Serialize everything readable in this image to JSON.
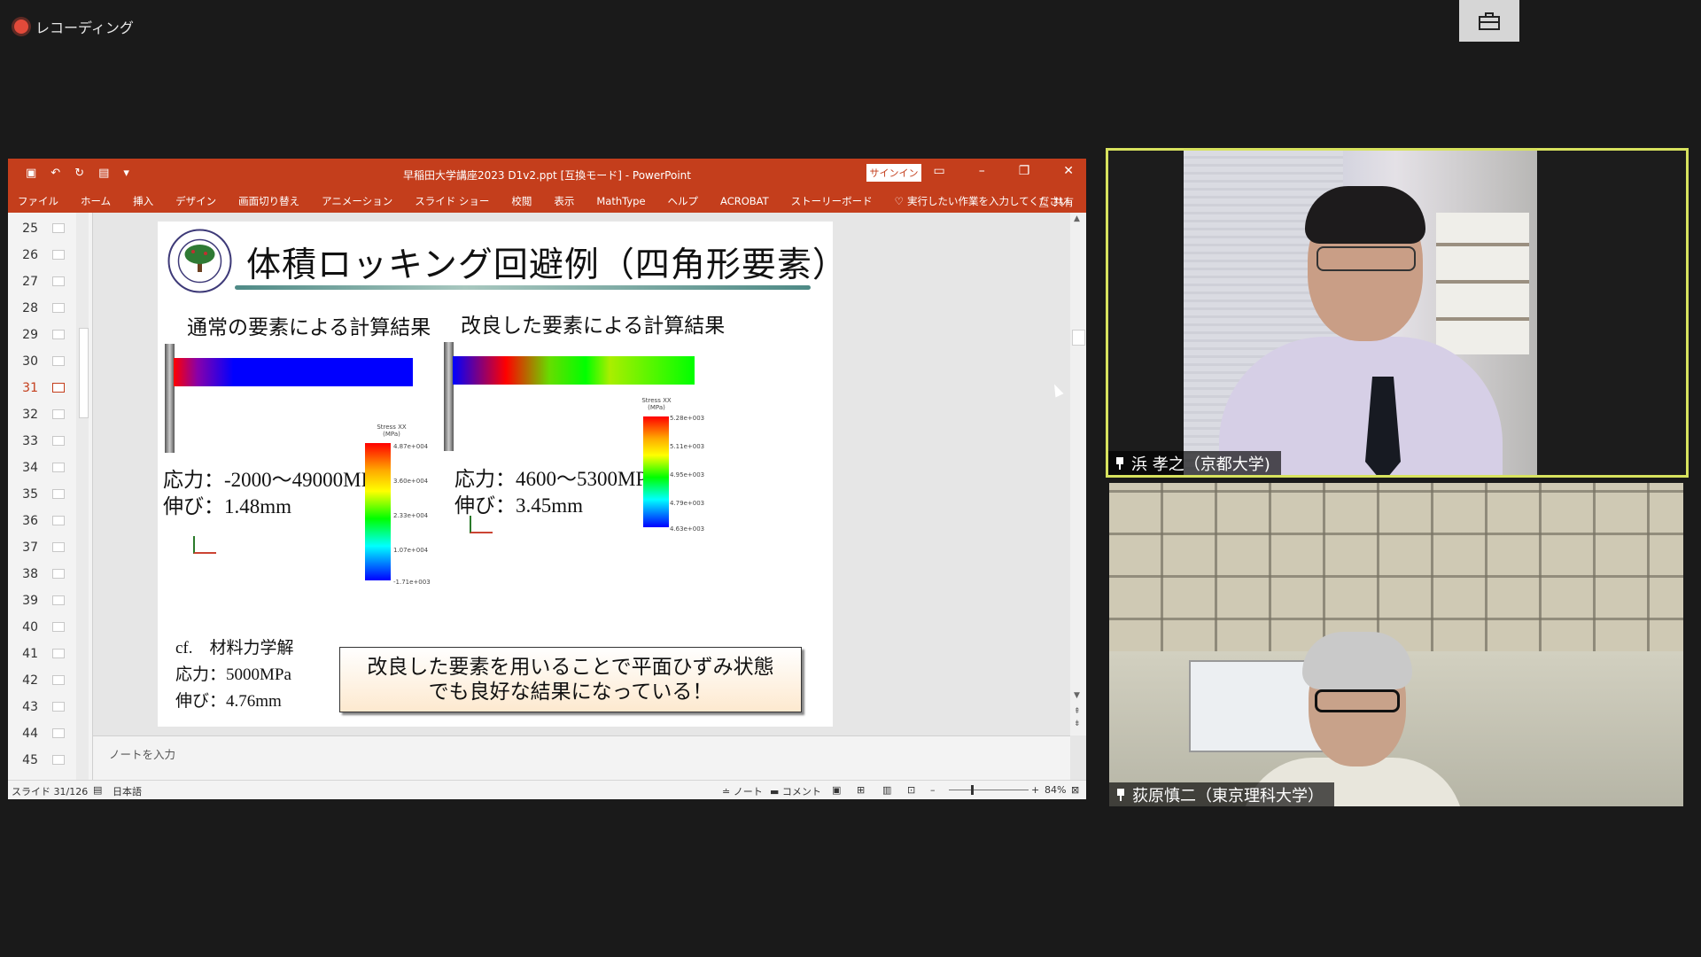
{
  "recording": {
    "label": "レコーディング"
  },
  "ppt": {
    "window_title": "早稲田大学講座2023 D1v2.ppt [互換モード]  -  PowerPoint",
    "signin_label": "サインイン",
    "ribbon_tabs": [
      "ファイル",
      "ホーム",
      "挿入",
      "デザイン",
      "画面切り替え",
      "アニメーション",
      "スライド ショー",
      "校閲",
      "表示",
      "MathType",
      "ヘルプ",
      "ACROBAT",
      "ストーリーボード"
    ],
    "tell_me": "実行したい作業を入力してください",
    "share": "共有",
    "slide_numbers": [
      "25",
      "26",
      "27",
      "28",
      "29",
      "30",
      "31",
      "32",
      "33",
      "34",
      "35",
      "36",
      "37",
      "38",
      "39",
      "40",
      "41",
      "42",
      "43",
      "44",
      "45"
    ],
    "active_slide": "31",
    "notes_placeholder": "ノートを入力",
    "status": {
      "slide_pos": "スライド 31/126",
      "language": "日本語",
      "notes_btn": "ノート",
      "comments_btn": "コメント",
      "zoom": "84%"
    }
  },
  "slide": {
    "title": "体積ロッキング回避例（四角形要素）",
    "left": {
      "heading": "通常の要素による計算結果",
      "stress": "応力：-2000～49000MPa",
      "elongation": "伸び：1.48mm",
      "legend_title": "Stress XX\n(MPa)",
      "legend_ticks": [
        "4.87e+004",
        "3.60e+004",
        "2.33e+004",
        "1.07e+004",
        "-1.71e+003"
      ]
    },
    "right": {
      "heading": "改良した要素による計算結果",
      "stress": "応力：4600～5300MPa",
      "elongation": "伸び：3.45mm",
      "legend_title": "Stress XX\n(MPa)",
      "legend_ticks": [
        "5.28e+003",
        "5.11e+003",
        "4.95e+003",
        "4.79e+003",
        "4.63e+003"
      ]
    },
    "reference": {
      "line1": "cf.　材料力学解",
      "line2": "応力：5000MPa",
      "line3": "伸び：4.76mm"
    },
    "callout": {
      "line1": "改良した要素を用いることで平面ひずみ状態",
      "line2": "でも良好な結果になっている！"
    }
  },
  "participants": [
    {
      "name": "浜 孝之（京都大学)"
    },
    {
      "name": "荻原慎二（東京理科大学）"
    }
  ],
  "colors": {
    "ppt_red": "#c43e1c",
    "active_speaker_border": "#d7e25e"
  }
}
